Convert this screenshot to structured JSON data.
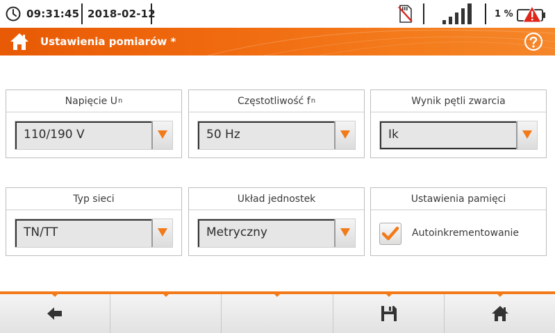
{
  "status": {
    "time": "09:31:45",
    "date": "2018-02-12",
    "battery_percent": "1 %",
    "signal_bars_shown": 5,
    "icons": [
      "clock-icon",
      "sd-card-crossed-icon",
      "signal-strength-icon",
      "battery-warning-icon"
    ]
  },
  "header": {
    "title": "Ustawienia pomiarów *",
    "icons": [
      "home-icon",
      "help-icon"
    ]
  },
  "panels": {
    "voltage": {
      "title": "Napięcie U",
      "title_sub": "n",
      "value": "110/190 V"
    },
    "frequency": {
      "title": "Częstotliwość f",
      "title_sub": "n",
      "value": "50 Hz"
    },
    "loop_result": {
      "title": "Wynik pętli zwarcia",
      "value": "Ik"
    },
    "network_type": {
      "title": "Typ sieci",
      "value": "TN/TT"
    },
    "units": {
      "title": "Układ jednostek",
      "value": "Metryczny"
    },
    "memory": {
      "title": "Ustawienia pamięci",
      "checkbox_label": "Autoinkrementowanie",
      "checked": true
    }
  },
  "toolbar": {
    "buttons": [
      "back-arrow-icon",
      "",
      "",
      "save-icon",
      "home-icon"
    ]
  },
  "colors": {
    "accent": "#f27a18",
    "header_start": "#e85a05",
    "header_end": "#f5862a",
    "warning_red": "#e0251b"
  }
}
